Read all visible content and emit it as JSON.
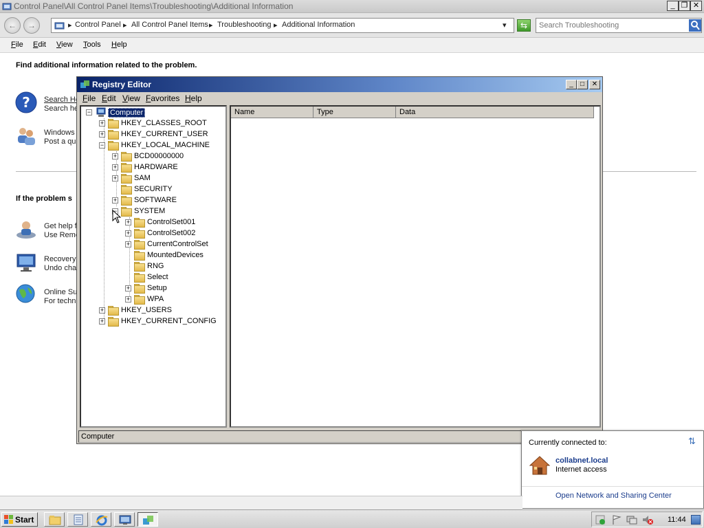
{
  "explorer": {
    "title": "Control Panel\\All Control Panel Items\\Troubleshooting\\Additional Information",
    "breadcrumbs": [
      "Control Panel",
      "All Control Panel Items",
      "Troubleshooting",
      "Additional Information"
    ],
    "search_placeholder": "Search Troubleshooting",
    "menu": [
      "File",
      "Edit",
      "View",
      "Tools",
      "Help"
    ],
    "heading": "Find additional information related to the problem.",
    "items_top": [
      {
        "title": "Search He",
        "desc": "Search he"
      },
      {
        "title": "Windows",
        "desc": "Post a qu"
      }
    ],
    "section2_heading": "If the problem s",
    "items_bottom": [
      {
        "title": "Get help f",
        "desc": "Use Remo"
      },
      {
        "title": "Recovery",
        "desc": "Undo cha"
      },
      {
        "title": "Online Su",
        "desc": "For techn"
      }
    ]
  },
  "regedit": {
    "title": "Registry Editor",
    "menu": [
      "File",
      "Edit",
      "View",
      "Favorites",
      "Help"
    ],
    "columns": [
      "Name",
      "Type",
      "Data"
    ],
    "status": "Computer",
    "tree": {
      "root": "Computer",
      "hives": [
        "HKEY_CLASSES_ROOT",
        "HKEY_CURRENT_USER",
        "HKEY_LOCAL_MACHINE"
      ],
      "hklm_children": [
        "BCD00000000",
        "HARDWARE",
        "SAM",
        "SECURITY",
        "SOFTWARE",
        "SYSTEM"
      ],
      "system_children": [
        "ControlSet001",
        "ControlSet002",
        "CurrentControlSet",
        "MountedDevices",
        "RNG",
        "Select",
        "Setup",
        "WPA"
      ],
      "hives_after": [
        "HKEY_USERS",
        "HKEY_CURRENT_CONFIG"
      ]
    }
  },
  "network_popup": {
    "header": "Currently connected to:",
    "network_name": "collabnet.local",
    "access": "Internet access",
    "link": "Open Network and Sharing Center"
  },
  "taskbar": {
    "start_label": "Start",
    "clock": "11:44"
  },
  "colors": {
    "regedit_title_start": "#0a246a",
    "regedit_title_end": "#a6caf0",
    "selection": "#0a246a",
    "link_blue": "#1a3c8c"
  }
}
